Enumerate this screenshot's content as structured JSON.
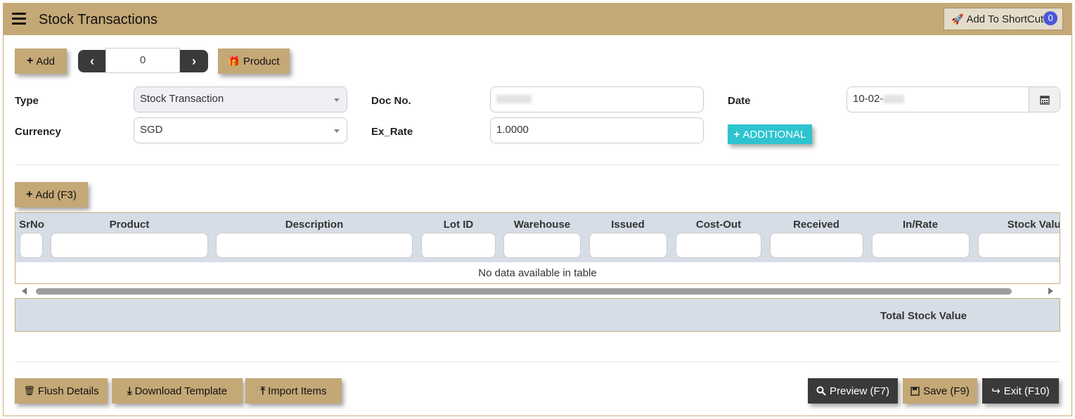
{
  "header": {
    "title": "Stock Transactions",
    "shortcut_label": "Add To ShortCut",
    "shortcut_count": "0"
  },
  "toolbar": {
    "add_label": "Add",
    "record_index": "0",
    "product_label": "Product"
  },
  "form": {
    "type_label": "Type",
    "type_value": "Stock Transaction",
    "docno_label": "Doc No.",
    "date_label": "Date",
    "date_value": "10-02-",
    "currency_label": "Currency",
    "currency_value": "SGD",
    "exrate_label": "Ex_Rate",
    "exrate_value": "1.0000",
    "additional_label": "ADDITIONAL"
  },
  "grid": {
    "add_label": "Add (F3)",
    "columns": [
      "SrNo",
      "Product",
      "Description",
      "Lot ID",
      "Warehouse",
      "Issued",
      "Cost-Out",
      "Received",
      "In/Rate",
      "Stock Value"
    ],
    "empty_text": "No data available in table",
    "total_label": "Total Stock Value"
  },
  "footer": {
    "flush_label": "Flush Details",
    "download_label": "Download Template",
    "import_label": "Import Items",
    "preview_label": "Preview (F7)",
    "save_label": "Save (F9)",
    "exit_label": "Exit (F10)"
  },
  "colors": {
    "header_bg": "#c4a876",
    "dark_button": "#3a3a3a",
    "additional_button": "#2ec4cf",
    "grid_header": "#d6dde6"
  }
}
